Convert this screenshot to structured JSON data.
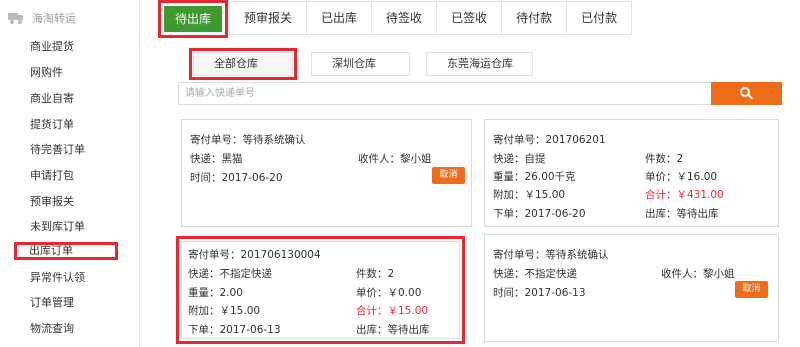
{
  "sidebar": {
    "header": "海淘转运",
    "items": [
      {
        "label": "商业提货"
      },
      {
        "label": "网购件"
      },
      {
        "label": "商业自寄"
      },
      {
        "label": "提货订单"
      },
      {
        "label": "待完善订单"
      },
      {
        "label": "申请打包"
      },
      {
        "label": "预审报关"
      },
      {
        "label": "未到库订单"
      },
      {
        "label": "出库订单"
      },
      {
        "label": "异常件认领"
      },
      {
        "label": "订单管理"
      },
      {
        "label": "物流查询"
      }
    ]
  },
  "tabs": [
    {
      "label": "待出库"
    },
    {
      "label": "预审报关"
    },
    {
      "label": "已出库"
    },
    {
      "label": "待签收"
    },
    {
      "label": "已签收"
    },
    {
      "label": "待付款"
    },
    {
      "label": "已付款"
    }
  ],
  "warehouses": [
    {
      "label": "全部仓库"
    },
    {
      "label": "深圳仓库"
    },
    {
      "label": "东莞海运仓库"
    }
  ],
  "search": {
    "placeholder": "请输入快递单号",
    "icon": "search-icon"
  },
  "cards": [
    {
      "order_no": "寄付单号：等待系统确认",
      "express": "快递：黑猫",
      "recipient": "收件人：黎小姐",
      "time": "时间：2017-06-20",
      "cancel": "取消"
    },
    {
      "order_no": "寄付单号：201706201",
      "express": "快递：自提",
      "pieces": "件数：2",
      "weight": "重量：26.00千克",
      "unit_price": "单价：￥16.00",
      "extra": "附加：￥15.00",
      "total": "合计：￥431.00",
      "order_date": "下单：2017-06-20",
      "status": "出库：等待出库"
    },
    {
      "order_no": "寄付单号：201706130004",
      "express": "快递：不指定快递",
      "pieces": "件数：2",
      "weight": "重量：2.00",
      "unit_price": "单价：￥0.00",
      "extra": "附加：￥15.00",
      "total": "合计：￥15.00",
      "order_date": "下单：2017-06-13",
      "status": "出库：等待出库"
    },
    {
      "order_no": "寄付单号：等待系统确认",
      "express": "快递：不指定快递",
      "recipient": "收件人：黎小姐",
      "time": "时间：2017-06-13",
      "cancel": "取消"
    }
  ],
  "colors": {
    "accent": "#ee6d1a",
    "active_tab": "#3c9a2e",
    "highlight": "#e8282e",
    "total_text": "#e8282e"
  }
}
